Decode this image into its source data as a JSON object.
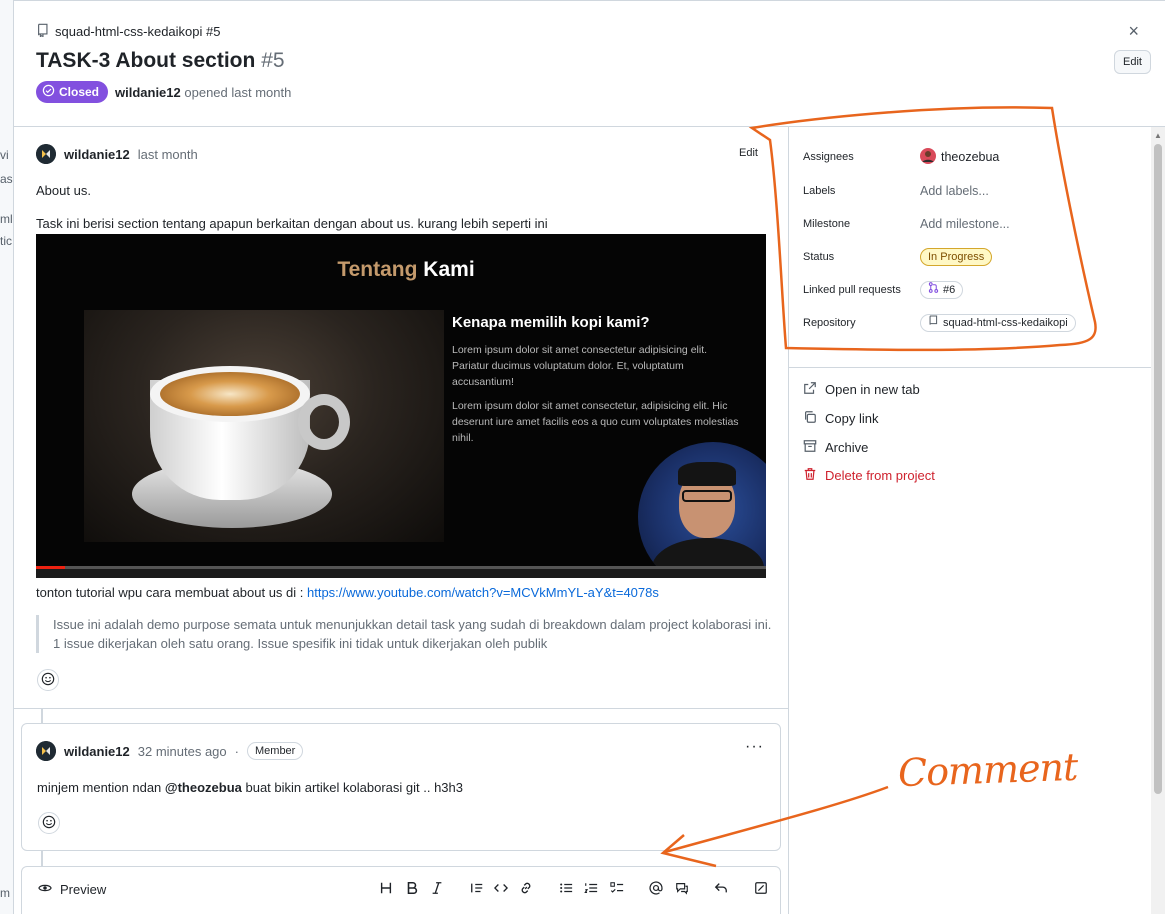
{
  "background": {
    "peek_texts": [
      "vi",
      "as",
      "ml-",
      "tic",
      "m"
    ]
  },
  "header": {
    "repo": "squad-html-css-kedaikopi #5",
    "title": "TASK-3 About section",
    "number": "#5",
    "state": "Closed",
    "author": "wildanie12",
    "opened_text": "opened last month",
    "edit_label": "Edit",
    "close_icon": "×"
  },
  "comment1": {
    "author": "wildanie12",
    "time": "last month",
    "edit_label": "Edit",
    "p1": "About us.",
    "p2": "Task ini berisi section tentang apapun berkaitan dengan about us. kurang lebih seperti ini",
    "link_prefix": "tonton tutorial wpu cara membuat about us di : ",
    "link_url": "https://www.youtube.com/watch?v=MCVkMmYL-aY&t=4078s",
    "quote_line1": "Issue ini adalah demo purpose semata untuk menunjukkan detail task yang sudah di breakdown dalam project kolaborasi ini.",
    "quote_line2": "1 issue dikerjakan oleh satu orang. Issue spesifik ini tidak untuk dikerjakan oleh publik"
  },
  "embed": {
    "title_a": "Tentang",
    "title_b": "Kami",
    "subtitle": "Kenapa memilih kopi kami?",
    "lorem1": "Lorem ipsum dolor sit amet consectetur adipisicing elit. Pariatur ducimus voluptatum dolor. Et, voluptatum accusantium!",
    "lorem2": "Lorem ipsum dolor sit amet consectetur, adipisicing elit. Hic deserunt iure amet facilis eos a quo cum voluptates molestias nihil.",
    "progress": 0.04
  },
  "comment2": {
    "author": "wildanie12",
    "time": "32 minutes ago",
    "dot": "·",
    "role": "Member",
    "menu": "···",
    "body_prefix": "minjem mention ndan ",
    "mention": "@theozebua",
    "body_suffix": " buat bikin artikel kolaborasi git .. h3h3"
  },
  "editor": {
    "preview_label": "Preview",
    "tools": [
      "heading-icon",
      "bold-icon",
      "italic-icon",
      "quote-icon",
      "code-icon",
      "link-icon",
      "bullet-list-icon",
      "numbered-list-icon",
      "task-list-icon",
      "mention-icon",
      "reference-icon",
      "undo-icon",
      "fullscreen-icon"
    ]
  },
  "sidebar": {
    "assignees_label": "Assignees",
    "assignee": "theozebua",
    "labels_label": "Labels",
    "labels_value": "Add labels...",
    "milestone_label": "Milestone",
    "milestone_value": "Add milestone...",
    "status_label": "Status",
    "status_value": "In Progress",
    "linked_label": "Linked pull requests",
    "linked_value": "#6",
    "repository_label": "Repository",
    "repository_value": "squad-html-css-kedaikopi",
    "actions": {
      "open": "Open in new tab",
      "copy": "Copy link",
      "archive": "Archive",
      "delete": "Delete from project"
    }
  },
  "annotation": {
    "label": "Comment",
    "color": "#e8651d"
  },
  "colors": {
    "closed": "#8250df",
    "link": "#0969da",
    "danger": "#cf222e",
    "status_bg": "#fff8c5"
  }
}
